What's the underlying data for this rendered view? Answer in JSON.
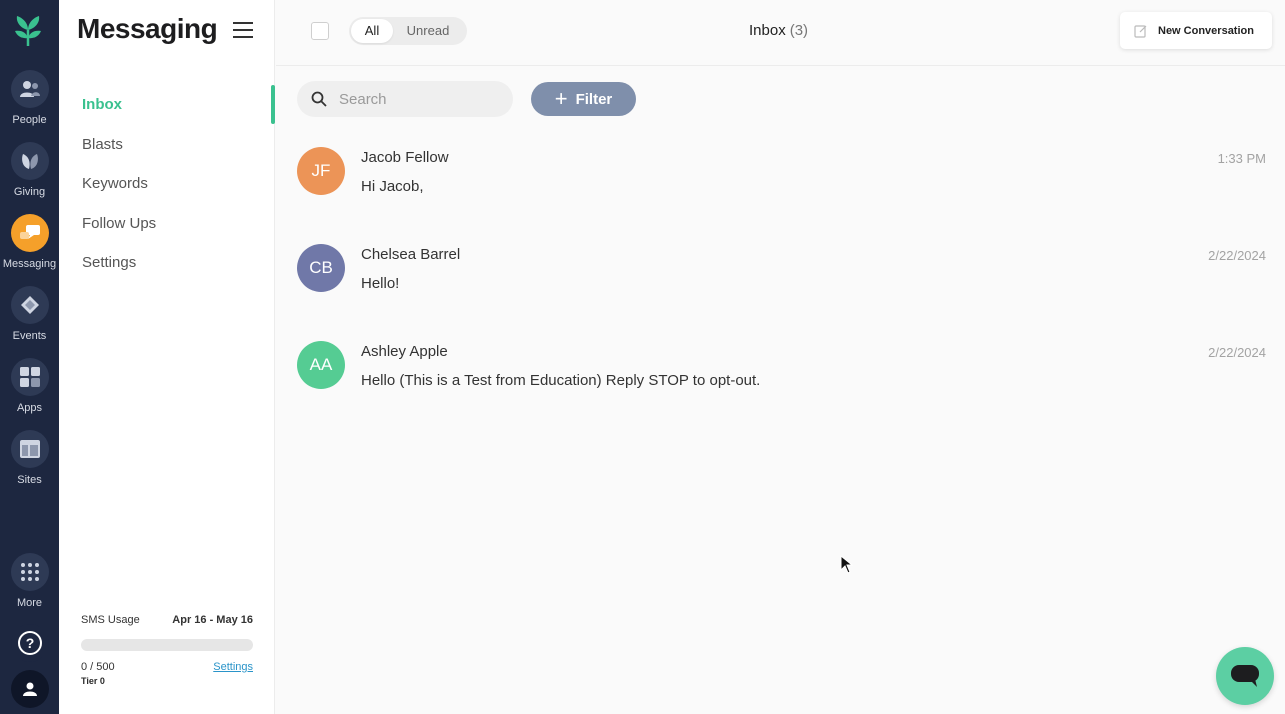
{
  "rail": {
    "items": [
      {
        "label": "People",
        "icon": "people-icon"
      },
      {
        "label": "Giving",
        "icon": "leaf-icon"
      },
      {
        "label": "Messaging",
        "icon": "chat-icon",
        "active": true
      },
      {
        "label": "Events",
        "icon": "ticket-icon"
      },
      {
        "label": "Apps",
        "icon": "grid-icon"
      },
      {
        "label": "Sites",
        "icon": "layout-icon"
      }
    ],
    "more_label": "More"
  },
  "subnav": {
    "title": "Messaging",
    "items": [
      {
        "label": "Inbox",
        "active": true
      },
      {
        "label": "Blasts"
      },
      {
        "label": "Keywords"
      },
      {
        "label": "Follow Ups"
      },
      {
        "label": "Settings"
      }
    ],
    "sms": {
      "label": "SMS Usage",
      "range": "Apr 16 - May 16",
      "used_text": "0 / 500",
      "used_fraction": 0,
      "settings_link": "Settings",
      "tier": "Tier 0"
    }
  },
  "header": {
    "toggle_all": "All",
    "toggle_unread": "Unread",
    "title": "Inbox",
    "count": "(3)",
    "new_conversation": "New Conversation"
  },
  "toolbar": {
    "search_placeholder": "Search",
    "filter_label": "Filter"
  },
  "conversations": [
    {
      "initials": "JF",
      "name": "Jacob Fellow",
      "message": "Hi Jacob,",
      "time": "1:33 PM",
      "color": "#ec9457"
    },
    {
      "initials": "CB",
      "name": "Chelsea Barrel",
      "message": "Hello!",
      "time": "2/22/2024",
      "color": "#7078a8"
    },
    {
      "initials": "AA",
      "name": "Ashley Apple",
      "message": "Hello (This is a Test from Education) Reply STOP to opt-out.",
      "time": "2/22/2024",
      "color": "#55cc93"
    }
  ],
  "colors": {
    "accent": "#3ac18f",
    "rail": "#1d2740",
    "active_app": "#f5a02a",
    "filter": "#7f8fab"
  }
}
